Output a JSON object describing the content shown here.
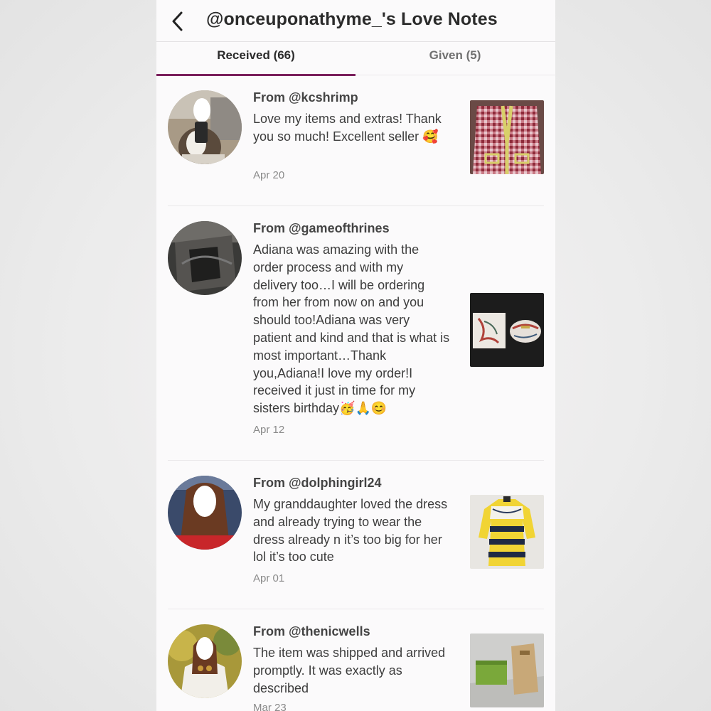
{
  "header": {
    "title": "@onceuponathyme_'s Love Notes",
    "back_icon": "chevron-left-icon"
  },
  "tabs": [
    {
      "label": "Received (66)",
      "active": true
    },
    {
      "label": "Given (5)",
      "active": false
    }
  ],
  "notes": [
    {
      "from": "From @kcshrimp",
      "message": "Love my items and extras! Thank you so much! Excellent seller 🥰",
      "date": "Apr 20"
    },
    {
      "from": "From @gameofthrines",
      "message": "Adiana was amazing with the order process and with my delivery too…I will be ordering from her from now on and you should too!Adiana was very patient and kind and that is what is most important…Thank you,Adiana!I love my order!I received it just in time for my sisters birthday🥳🙏😊",
      "date": "Apr 12"
    },
    {
      "from": "From @dolphingirl24",
      "message": "My granddaughter loved the dress and already trying to wear the dress already n it’s too big for her lol it’s too cute",
      "date": "Apr 01"
    },
    {
      "from": "From @thenicwells",
      "message": "The item was shipped and arrived promptly. It was exactly as described",
      "date": "Mar 23"
    }
  ],
  "colors": {
    "accent": "#7a1f5c",
    "text": "#2b2b2b",
    "muted": "#8a8a8a"
  }
}
